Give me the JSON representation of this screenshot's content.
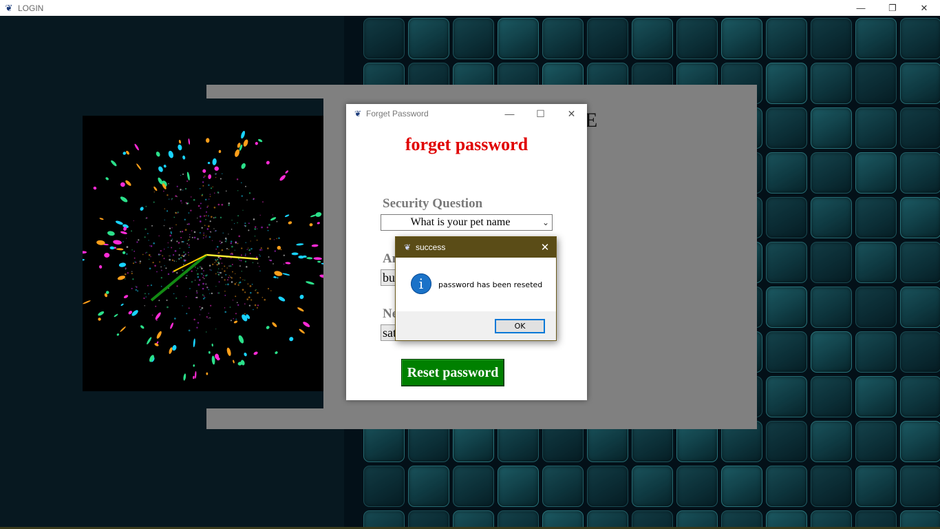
{
  "app": {
    "window_title": "LOGIN",
    "login_title_fragment": "E"
  },
  "forget_window": {
    "title": "Forget Password",
    "heading": "forget password",
    "security_question_label": "Security Question",
    "security_question_value": "What is your pet name",
    "answer_label": "An",
    "answer_value": "bu",
    "new_password_label": "Ne",
    "new_password_value": "sat",
    "reset_button": "Reset password"
  },
  "dialog": {
    "title": "success",
    "message": "password has been reseted",
    "ok_label": "OK",
    "icon": "info-icon"
  },
  "colors": {
    "heading_red": "#e00000",
    "reset_green": "#008000",
    "dialog_titlebar": "#5a4c17",
    "panel_gray": "#808080",
    "info_blue": "#1a72c8"
  },
  "icons": {
    "app": "feather-icon",
    "minimize": "minimize-icon",
    "maximize": "maximize-icon",
    "close": "close-icon",
    "dropdown": "chevron-down-icon"
  }
}
